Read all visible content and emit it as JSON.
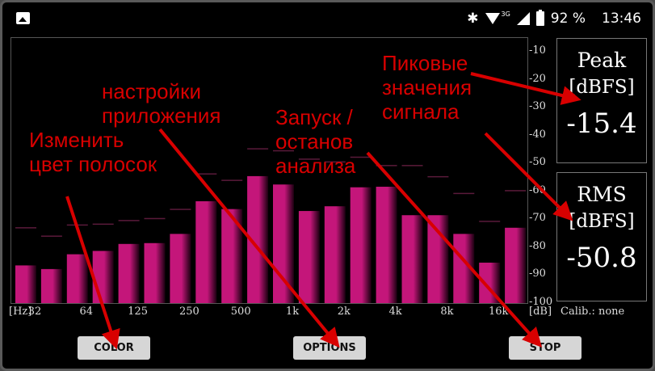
{
  "status_bar": {
    "battery": "92 %",
    "time": "13:46",
    "network": "3G"
  },
  "chart_data": {
    "type": "bar",
    "categories": [
      "32",
      "",
      "64",
      "",
      "125",
      "",
      "250",
      "",
      "500",
      "",
      "1k",
      "",
      "2k",
      "",
      "4k",
      "",
      "8k",
      "",
      "16k"
    ],
    "values": [
      -86.5,
      -87.8,
      -82.5,
      -81.3,
      -78.8,
      -78.5,
      -75.2,
      -63.5,
      -66.3,
      -54.5,
      -57.5,
      -67,
      -65.3,
      -58.5,
      -58.3,
      -68.5,
      -68.5,
      -75.2,
      -85.5,
      -73
    ],
    "peak_hold": [
      -72.8,
      -75.8,
      -71.8,
      -71.5,
      -70.2,
      -69.5,
      -66.2,
      -53.5,
      -55.8,
      -44.5,
      -45.2,
      -48.2,
      -49.2,
      -47.5,
      -50.5,
      -50.5,
      -54.5,
      -60.5,
      -70.5,
      -59.5
    ],
    "ylim": [
      -100,
      -5
    ],
    "y_ticks": [
      "-10",
      "-20",
      "-30",
      "-40",
      "-50",
      "-60",
      "-70",
      "-80",
      "-90",
      "-100"
    ],
    "x_unit": "[Hz]",
    "y_unit": "[dB]",
    "bar_color": "#c4167a"
  },
  "calibration": "Calib.: none",
  "peak_panel": {
    "title": "Peak",
    "unit": "[dBFS]",
    "value": "-15.4"
  },
  "rms_panel": {
    "title": "RMS",
    "unit": "[dBFS]",
    "value": "-50.8"
  },
  "buttons": {
    "color": "COLOR",
    "options": "OPTIONS",
    "stop": "STOP"
  },
  "annotations": {
    "color_note": "Изменить\nцвет полосок",
    "options_note": "настройки\nприложения",
    "start_note": "Запуск /\nостанов\nанализа",
    "peak_note": "Пиковые\nзначения\nсигнала"
  },
  "colors": {
    "annotation": "#d80000",
    "background": "#000000"
  }
}
